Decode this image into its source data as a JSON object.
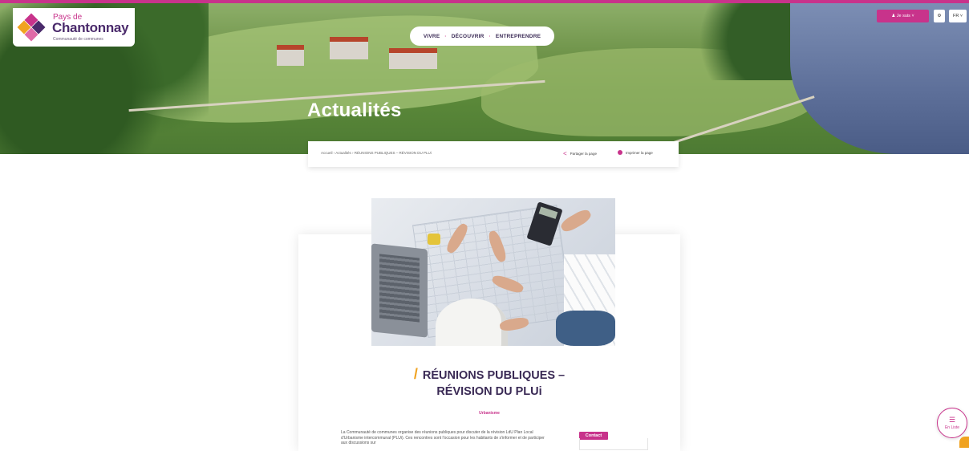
{
  "header": {
    "logo": {
      "pays": "Pays de",
      "name": "Chantonnay",
      "sub": "Communauté de communes"
    },
    "nav": [
      "VIVRE",
      "DÉCOUVRIR",
      "ENTREPRENDRE"
    ],
    "nav_separator": "·",
    "top_buttons": {
      "jesuis": "Je suis",
      "lang": "FR",
      "acc": "⚙"
    }
  },
  "hero": {
    "title": "Actualités"
  },
  "toolbar": {
    "breadcrumb": "Accueil › Actualités › RÉUNIONS PUBLIQUES – RÉVISION DU PLUi",
    "share_label": "Partager la page",
    "print_label": "Imprimer la page"
  },
  "article": {
    "title_line1": "RÉUNIONS PUBLIQUES –",
    "title_line2": "RÉVISION DU PLUi",
    "tag": "Urbanisme",
    "body": "La Communauté de communes organise des réunions publiques pour discuter de la révision LdU Plan Local d'Urbanisme intercommunal (PLUi). Ces rencontres sont l'occasion pour les habitants de s'informer et de participer aux discussions sur",
    "contact_label": "Contact"
  },
  "floating": {
    "enliste_label": "En Liste"
  },
  "colors": {
    "accent": "#c8338b",
    "brand_dark": "#3a2a55",
    "slash": "#f0a321"
  }
}
